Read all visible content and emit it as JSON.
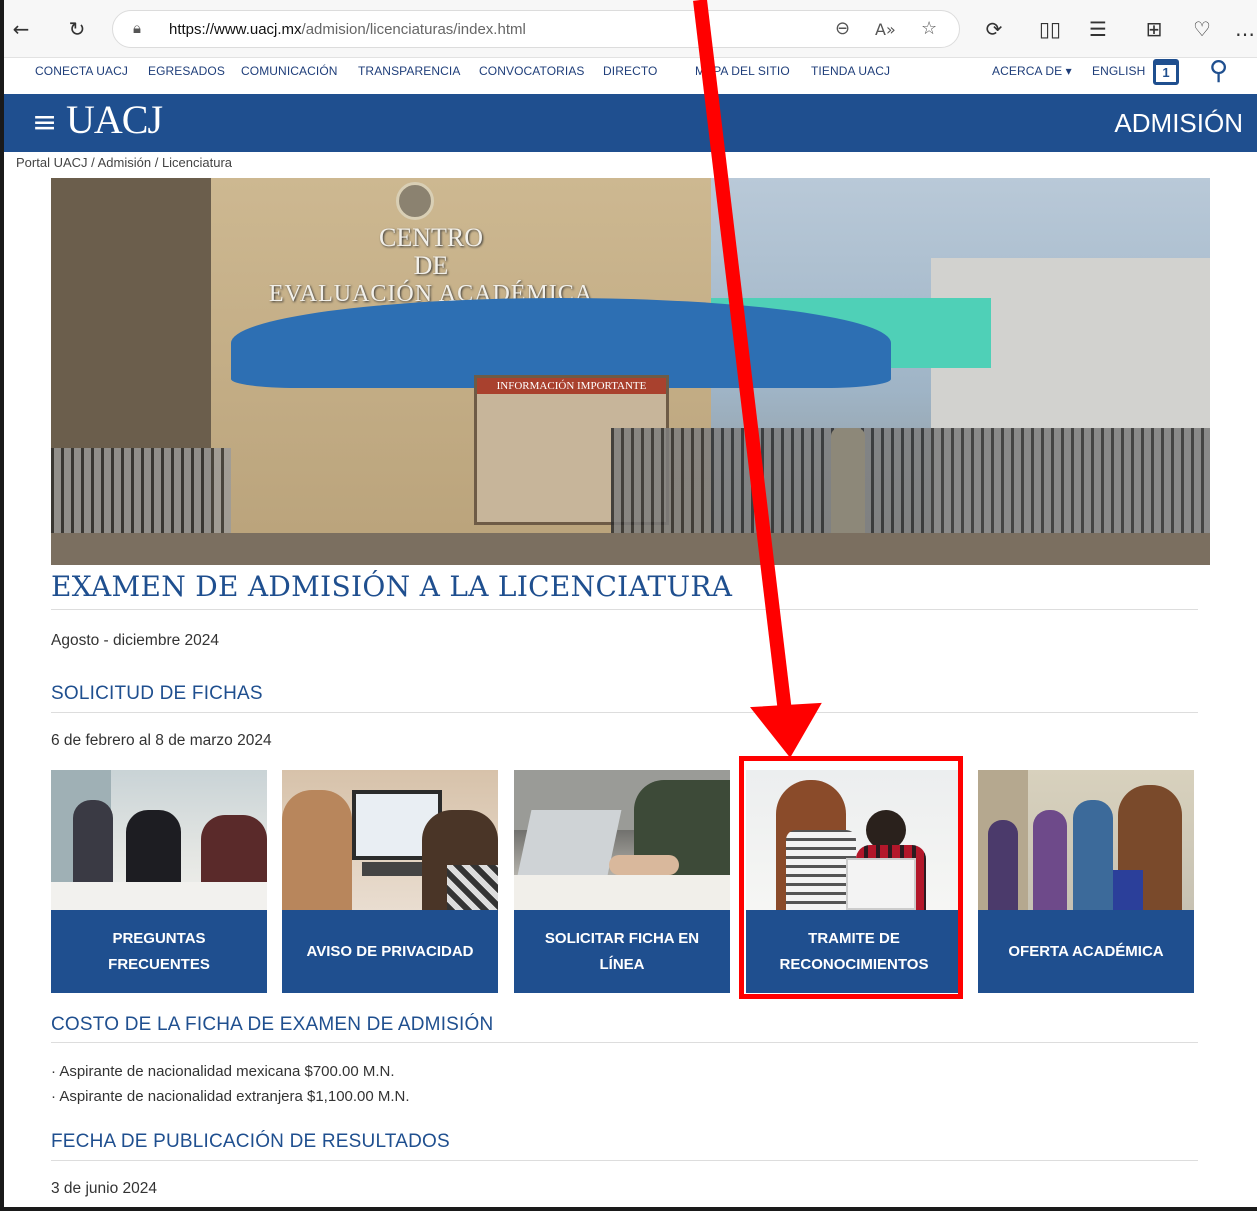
{
  "browser": {
    "url_host": "https://www.uacj.mx",
    "url_rest": "/admision/licenciaturas/index.html"
  },
  "toplinks": {
    "items": [
      "CONECTA UACJ",
      "EGRESADOS",
      "COMUNICACIÓN",
      "TRANSPARENCIA",
      "CONVOCATORIAS",
      "DIRECTO",
      "MAPA DEL SITIO",
      "TIENDA UACJ"
    ],
    "acerca": "ACERCA DE ▾",
    "english": "ENGLISH",
    "calendar_day": "1"
  },
  "header": {
    "logo": "UACJ",
    "section": "ADMISIÓN"
  },
  "breadcrumb": "Portal UACJ  /  Admisión  /  Licenciatura",
  "hero": {
    "sign_line1": "CENTRO",
    "sign_line2": "DE",
    "sign_line3": "EVALUACIÓN   ACADÉMICA",
    "board_title": "INFORMACIÓN IMPORTANTE"
  },
  "main": {
    "title": "EXAMEN DE ADMISIÓN A LA LICENCIATURA",
    "period": "Agosto - diciembre 2024",
    "fichas_heading": "SOLICITUD DE FICHAS",
    "fichas_dates": "6 de febrero al 8 de marzo 2024",
    "cards": [
      {
        "label": "PREGUNTAS FRECUENTES"
      },
      {
        "label": "AVISO DE PRIVACIDAD"
      },
      {
        "label": "SOLICITAR FICHA EN LÍNEA"
      },
      {
        "label": "TRAMITE DE RECONOCIMIENTOS"
      },
      {
        "label": "OFERTA ACADÉMICA"
      }
    ],
    "costo_heading": "COSTO DE LA FICHA DE EXAMEN DE ADMISIÓN",
    "costo_mx": "· Aspirante de nacionalidad mexicana $700.00 M.N.",
    "costo_ext": "· Aspirante de nacionalidad extranjera $1,100.00 M.N.",
    "resultados_heading": "FECHA DE PUBLICACIÓN DE RESULTADOS",
    "resultados_date": "3 de junio 2024"
  },
  "colors": {
    "brand_blue": "#1f4f8f",
    "highlight_red": "#ff0000"
  }
}
